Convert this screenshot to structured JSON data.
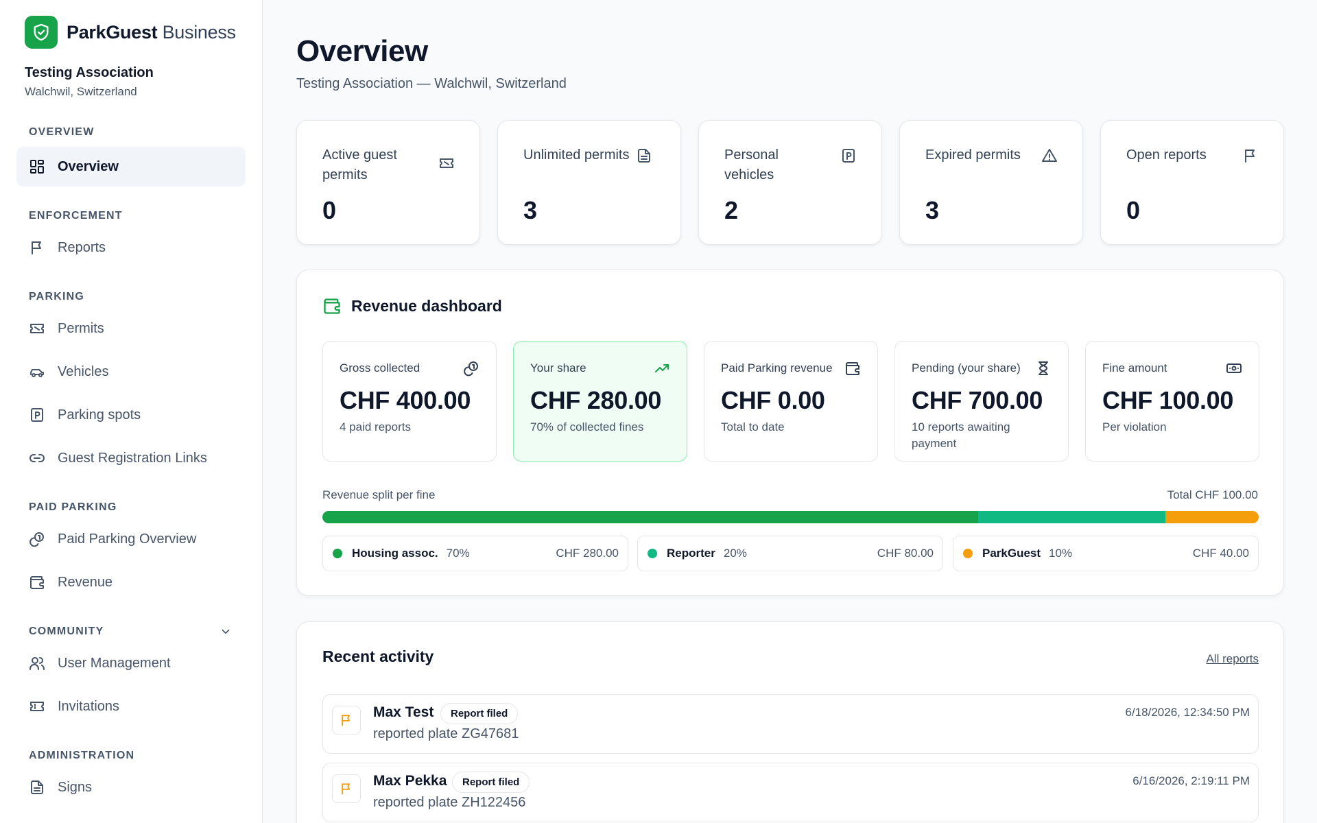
{
  "brand": {
    "name_bold": "ParkGuest",
    "name_light": "Business"
  },
  "org": {
    "name": "Testing Association",
    "location": "Walchwil, Switzerland"
  },
  "sidebar": {
    "sections": {
      "overview": "Overview",
      "enforcement": "Enforcement",
      "parking": "Parking",
      "paid_parking": "Paid Parking",
      "community": "Community",
      "administration": "Administration"
    },
    "items": {
      "overview": "Overview",
      "reports": "Reports",
      "permits": "Permits",
      "vehicles": "Vehicles",
      "parking_spots": "Parking spots",
      "guest_links": "Guest Registration Links",
      "paid_overview": "Paid Parking Overview",
      "revenue": "Revenue",
      "user_management": "User Management",
      "invitations": "Invitations",
      "signs": "Signs"
    },
    "active": "overview"
  },
  "header": {
    "title": "Overview",
    "subtitle": "Testing Association — Walchwil, Switzerland"
  },
  "stats": [
    {
      "label": "Active guest permits",
      "value": "0",
      "icon": "ticket-icon"
    },
    {
      "label": "Unlimited permits",
      "value": "3",
      "icon": "document-icon"
    },
    {
      "label": "Personal vehicles",
      "value": "2",
      "icon": "parking-icon"
    },
    {
      "label": "Expired permits",
      "value": "3",
      "icon": "warning-icon"
    },
    {
      "label": "Open reports",
      "value": "0",
      "icon": "flag-icon"
    }
  ],
  "revenue": {
    "title": "Revenue dashboard",
    "cards": [
      {
        "label": "Gross collected",
        "value": "CHF 400.00",
        "note": "4 paid reports",
        "icon": "coins-icon"
      },
      {
        "label": "Your share",
        "value": "CHF 280.00",
        "note": "70% of collected fines",
        "icon": "trending-up-icon"
      },
      {
        "label": "Paid Parking revenue",
        "value": "CHF 0.00",
        "note": "Total to date",
        "icon": "wallet-icon"
      },
      {
        "label": "Pending (your share)",
        "value": "CHF 700.00",
        "note": "10 reports awaiting payment",
        "icon": "hourglass-icon"
      },
      {
        "label": "Fine amount",
        "value": "CHF 100.00",
        "note": "Per violation",
        "icon": "banknote-icon"
      }
    ],
    "split_label": "Revenue split per fine",
    "split_total": "Total CHF 100.00",
    "split": [
      {
        "name": "Housing assoc.",
        "pct_label": "70%",
        "share": 0.7,
        "amount": "CHF 280.00",
        "color": "#16a34a"
      },
      {
        "name": "Reporter",
        "pct_label": "20%",
        "share": 0.2,
        "amount": "CHF 80.00",
        "color": "#10b981"
      },
      {
        "name": "ParkGuest",
        "pct_label": "10%",
        "share": 0.1,
        "amount": "CHF 40.00",
        "color": "#f59e0b"
      }
    ]
  },
  "activity": {
    "title": "Recent activity",
    "all_link": "All reports",
    "items": [
      {
        "name": "Max Test",
        "badge": "Report filed",
        "description": "reported plate ZG47681",
        "time": "6/18/2026, 12:34:50 PM"
      },
      {
        "name": "Max Pekka",
        "badge": "Report filed",
        "description": "reported plate ZH122456",
        "time": "6/16/2026, 2:19:11 PM"
      }
    ]
  },
  "colors": {
    "brand": "#16a34a",
    "accent_teal": "#10b981",
    "accent_orange": "#f59e0b"
  }
}
